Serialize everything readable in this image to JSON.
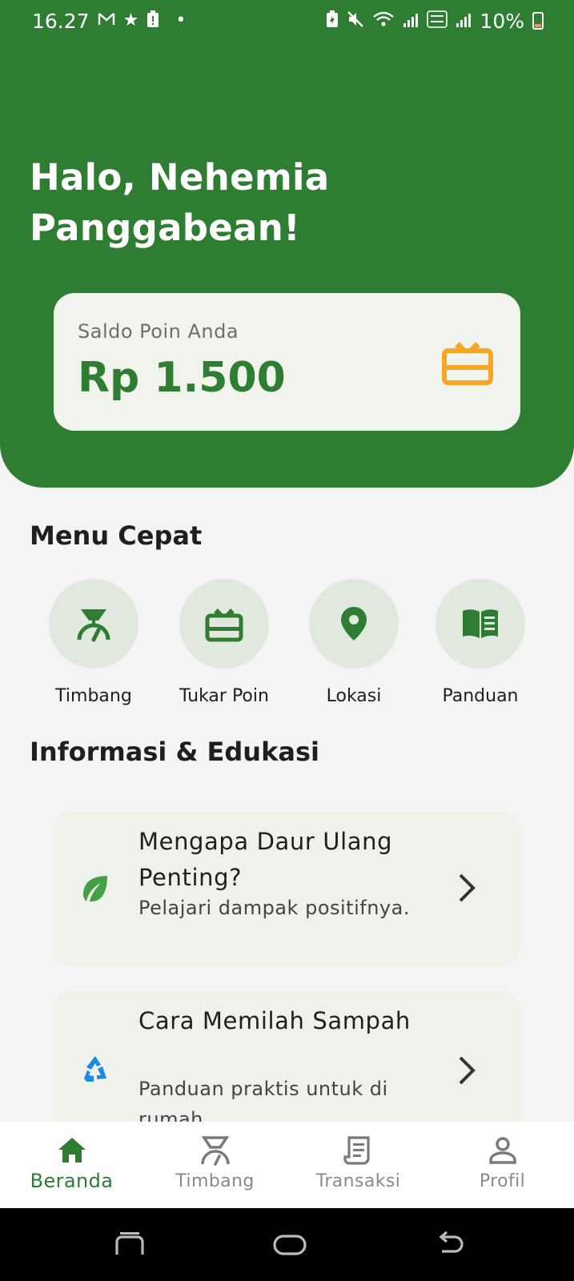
{
  "status_bar": {
    "time": "16.27",
    "battery_percent": "10%",
    "left_icons": [
      "gmail-icon",
      "star-icon",
      "alert-icon",
      "dot-icon"
    ],
    "right_icons": [
      "battery-saver-icon",
      "mute-icon",
      "wifi-icon",
      "signal-icon",
      "volte-icon",
      "signal-icon"
    ]
  },
  "header": {
    "greeting": "Halo, Nehemia Panggabean!",
    "color": "#2e7d32"
  },
  "balance": {
    "label": "Saldo Poin Anda",
    "value": "Rp 1.500",
    "icon": "gift-card-icon",
    "icon_color": "#f5a623"
  },
  "quick_menu": {
    "title": "Menu Cepat",
    "items": [
      {
        "label": "Timbang",
        "icon": "scale-icon"
      },
      {
        "label": "Tukar Poin",
        "icon": "redeem-icon"
      },
      {
        "label": "Lokasi",
        "icon": "location-icon"
      },
      {
        "label": "Panduan",
        "icon": "book-icon"
      }
    ]
  },
  "info": {
    "title": "Informasi & Edukasi",
    "cards": [
      {
        "title": "Mengapa Daur Ulang Penting?",
        "subtitle": "Pelajari dampak positifnya.",
        "icon": "leaf-icon"
      },
      {
        "title": "Cara Memilah Sampah",
        "subtitle": "Panduan praktis untuk di rumah.",
        "icon": "recycle-icon"
      }
    ]
  },
  "bottom_nav": {
    "items": [
      {
        "label": "Beranda",
        "icon": "home-icon",
        "active": true
      },
      {
        "label": "Timbang",
        "icon": "scale-icon",
        "active": false
      },
      {
        "label": "Transaksi",
        "icon": "receipt-icon",
        "active": false
      },
      {
        "label": "Profil",
        "icon": "person-icon",
        "active": false
      }
    ]
  },
  "colors": {
    "primary": "#2e7d32",
    "accent": "#f5a623",
    "recycle": "#1e88e5",
    "leaf": "#43a047"
  }
}
